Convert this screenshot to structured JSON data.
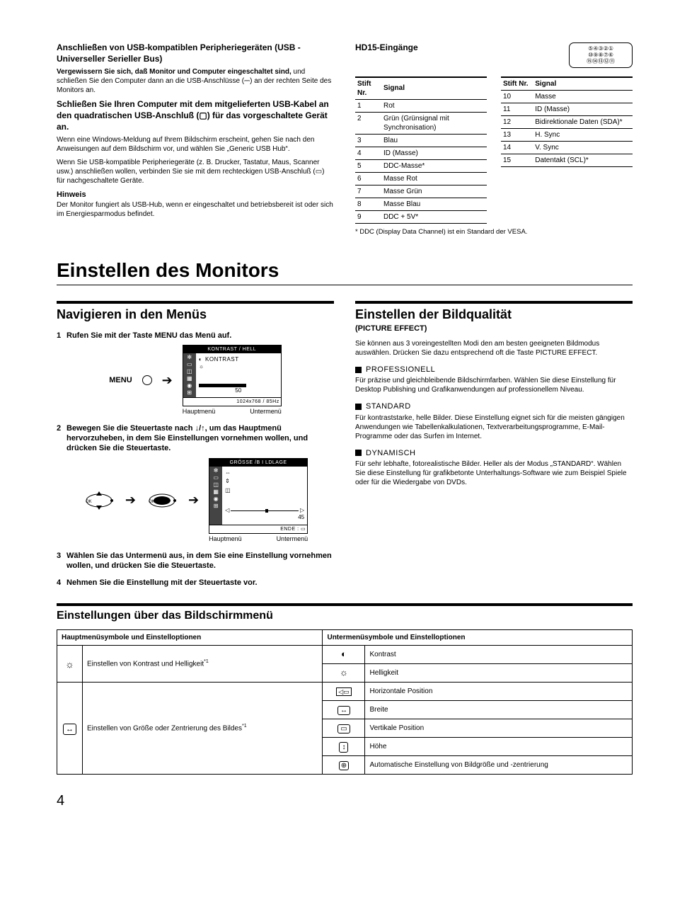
{
  "usb": {
    "h1": "Anschließen von USB-kompatiblen Peripheriegeräten (USB - Universeller Serieller Bus)",
    "p1a": "Vergewissern Sie sich, daß Monitor und Computer eingeschaltet sind,",
    "p1b": " und schließen Sie den Computer dann an die USB-Anschlüsse (",
    "p1c": ") an der rechten Seite des Monitors an.",
    "h2": "Schließen Sie Ihren Computer mit dem mitgelieferten USB-Kabel an den quadratischen USB-Anschluß (",
    "h2b": ") für das vorgeschaltete Gerät an.",
    "p2": "Wenn eine Windows-Meldung auf Ihrem Bildschirm erscheint, gehen Sie nach den Anweisungen auf dem Bildschirm vor, und wählen Sie „Generic USB Hub“.",
    "p3a": "Wenn Sie USB-kompatible Peripheriegeräte (z. B. Drucker, Tastatur, Maus, Scanner usw.) anschließen wollen, verbinden Sie sie mit dem rechteckigen USB-Anschluß (",
    "p3b": ") für nachgeschaltete Geräte.",
    "note_label": "Hinweis",
    "note": "Der Monitor fungiert als USB-Hub, wenn er eingeschaltet und betriebsbereit ist oder sich im Energiesparmodus befindet."
  },
  "hd15": {
    "title": "HD15-Eingänge",
    "diagram": {
      "r1": "⑤④③②①",
      "r2": "⑩⑨⑧⑦⑥",
      "r3": "⑮⑭⑬⑫⑪"
    },
    "col_pin": "Stift Nr.",
    "col_sig": "Signal",
    "left": [
      {
        "n": "1",
        "s": "Rot"
      },
      {
        "n": "2",
        "s": "Grün (Grünsignal mit Synchronisation)"
      },
      {
        "n": "3",
        "s": "Blau"
      },
      {
        "n": "4",
        "s": "ID (Masse)"
      },
      {
        "n": "5",
        "s": "DDC-Masse*"
      },
      {
        "n": "6",
        "s": "Masse Rot"
      },
      {
        "n": "7",
        "s": "Masse Grün"
      },
      {
        "n": "8",
        "s": "Masse Blau"
      },
      {
        "n": "9",
        "s": "DDC + 5V*"
      }
    ],
    "right": [
      {
        "n": "10",
        "s": "Masse"
      },
      {
        "n": "11",
        "s": "ID (Masse)"
      },
      {
        "n": "12",
        "s": "Bidirektionale Daten (SDA)*"
      },
      {
        "n": "13",
        "s": "H. Sync"
      },
      {
        "n": "14",
        "s": "V. Sync"
      },
      {
        "n": "15",
        "s": "Datentakt (SCL)*"
      }
    ],
    "footnote": "* DDC (Display Data Channel) ist ein Standard der VESA."
  },
  "settings": {
    "h1": "Einstellen des Monitors",
    "nav_h": "Navigieren in den Menüs",
    "step1": "Rufen Sie mit der Taste MENU das Menü auf.",
    "menu_label": "MENU",
    "osd1": {
      "title": "KONTRAST / HELL",
      "item": "KONTRAST",
      "val": "50",
      "footer": "1024x768 / 85Hz"
    },
    "cap_main": "Hauptmenü",
    "cap_sub": "Untermenü",
    "step2": "Bewegen Sie die Steuertaste nach ↓/↑, um das Hauptmenü hervorzuheben, in dem Sie Einstellungen vornehmen wollen, und drücken Sie die Steuertaste.",
    "osd2": {
      "title": "GRÖSSE /B I LDLAGE",
      "val": "45",
      "footer": "ENDE : ▭"
    },
    "step3": "Wählen Sie das Untermenü aus, in dem Sie eine Einstellung vornehmen wollen, und drücken Sie die Steuertaste.",
    "step4": "Nehmen Sie die Einstellung mit der Steuertaste vor."
  },
  "quality": {
    "h": "Einstellen der Bildqualität",
    "sub": "(PICTURE EFFECT)",
    "intro": "Sie können aus 3 voreingestellten Modi den am besten geeigneten Bildmodus auswählen. Drücken Sie dazu entsprechend oft die Taste PICTURE EFFECT.",
    "modes": [
      {
        "name": "PROFESSIONELL",
        "desc": "Für präzise und gleichbleibende Bildschirmfarben. Wählen Sie diese Einstellung für Desktop Publishing und Grafikanwendungen auf professionellem Niveau."
      },
      {
        "name": "STANDARD",
        "desc": "Für kontraststarke, helle Bilder. Diese Einstellung eignet sich für die meisten gängigen Anwendungen wie Tabellenkalkulationen, Textverarbeitungsprogramme, E-Mail-Programme oder das Surfen im Internet."
      },
      {
        "name": "DYNAMISCH",
        "desc": "Für sehr lebhafte, fotorealistische Bilder. Heller als der Modus „STANDARD“. Wählen Sie diese Einstellung für grafikbetonte Unterhaltungs-Software wie zum Beispiel Spiele oder für die Wiedergabe von DVDs."
      }
    ]
  },
  "menuset": {
    "h": "Einstellungen über das Bildschirmmenü",
    "th_main": "Hauptmenüsymbole und Einstelloptionen",
    "th_sub": "Untermenüsymbole und Einstelloptionen",
    "g1_desc_a": "Einstellen von Kontrast und Helligkeit",
    "sup": "*1",
    "g1_rows": [
      {
        "icon": "◐",
        "label": "Kontrast"
      },
      {
        "icon": "☼",
        "label": "Helligkeit"
      }
    ],
    "g2_desc_a": "Einstellen von Größe oder Zentrierung des Bildes",
    "g2_rows": [
      {
        "label": "Horizontale Position"
      },
      {
        "label": "Breite"
      },
      {
        "label": "Vertikale Position"
      },
      {
        "label": "Höhe"
      },
      {
        "label": "Automatische Einstellung von Bildgröße und -zentrierung"
      }
    ]
  },
  "page": "4"
}
